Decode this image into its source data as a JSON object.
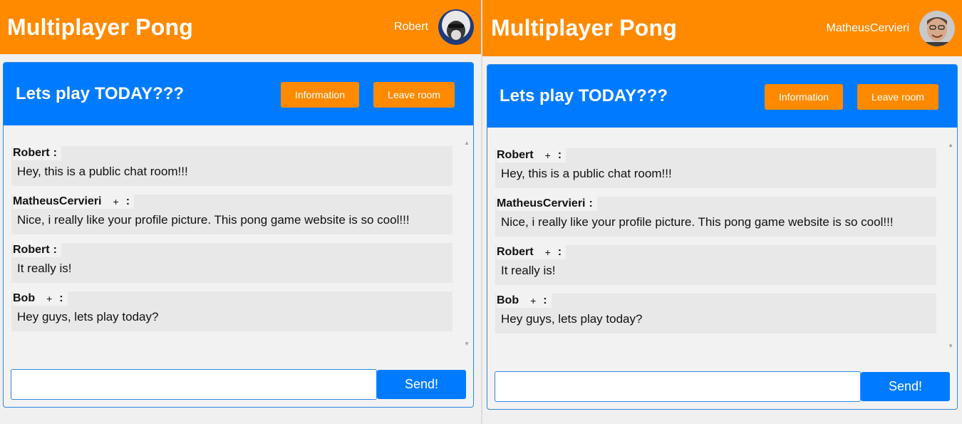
{
  "left": {
    "app_title": "Multiplayer Pong",
    "username": "Robert",
    "room": {
      "title": "Lets play TODAY???",
      "info_button": "Information",
      "leave_button": "Leave room",
      "send_button": "Send!",
      "input_value": "",
      "messages": [
        {
          "author": "Robert",
          "plus": "",
          "colon": ":",
          "text": "Hey, this is a public chat room!!!"
        },
        {
          "author": "MatheusCervieri",
          "plus": "+",
          "colon": ":",
          "text": "Nice, i really like your profile picture. This pong game website is so cool!!!"
        },
        {
          "author": "Robert",
          "plus": "",
          "colon": ":",
          "text": "It really is!"
        },
        {
          "author": "Bob",
          "plus": "+",
          "colon": ":",
          "text": "Hey guys, lets play today?"
        }
      ]
    }
  },
  "right": {
    "app_title": "Multiplayer Pong",
    "username": "MatheusCervieri",
    "room": {
      "title": "Lets play TODAY???",
      "info_button": "Information",
      "leave_button": "Leave room",
      "send_button": "Send!",
      "input_value": "",
      "messages": [
        {
          "author": "Robert",
          "plus": "+",
          "colon": ":",
          "text": "Hey, this is a public chat room!!!"
        },
        {
          "author": "MatheusCervieri",
          "plus": "",
          "colon": ":",
          "text": "Nice, i really like your profile picture. This pong game website is so cool!!!"
        },
        {
          "author": "Robert",
          "plus": "+",
          "colon": ":",
          "text": "It really is!"
        },
        {
          "author": "Bob",
          "plus": "+",
          "colon": ":",
          "text": "Hey guys, lets play today?"
        }
      ]
    }
  },
  "colors": {
    "header": "#ff8a00",
    "room_header": "#007bff",
    "button_orange": "#ff8a00",
    "send": "#007bff"
  },
  "icons": {
    "avatar_left": "avatar",
    "avatar_right": "avatar",
    "scroll_up": "scroll-up-arrow-icon",
    "scroll_down": "scroll-down-arrow-icon"
  }
}
